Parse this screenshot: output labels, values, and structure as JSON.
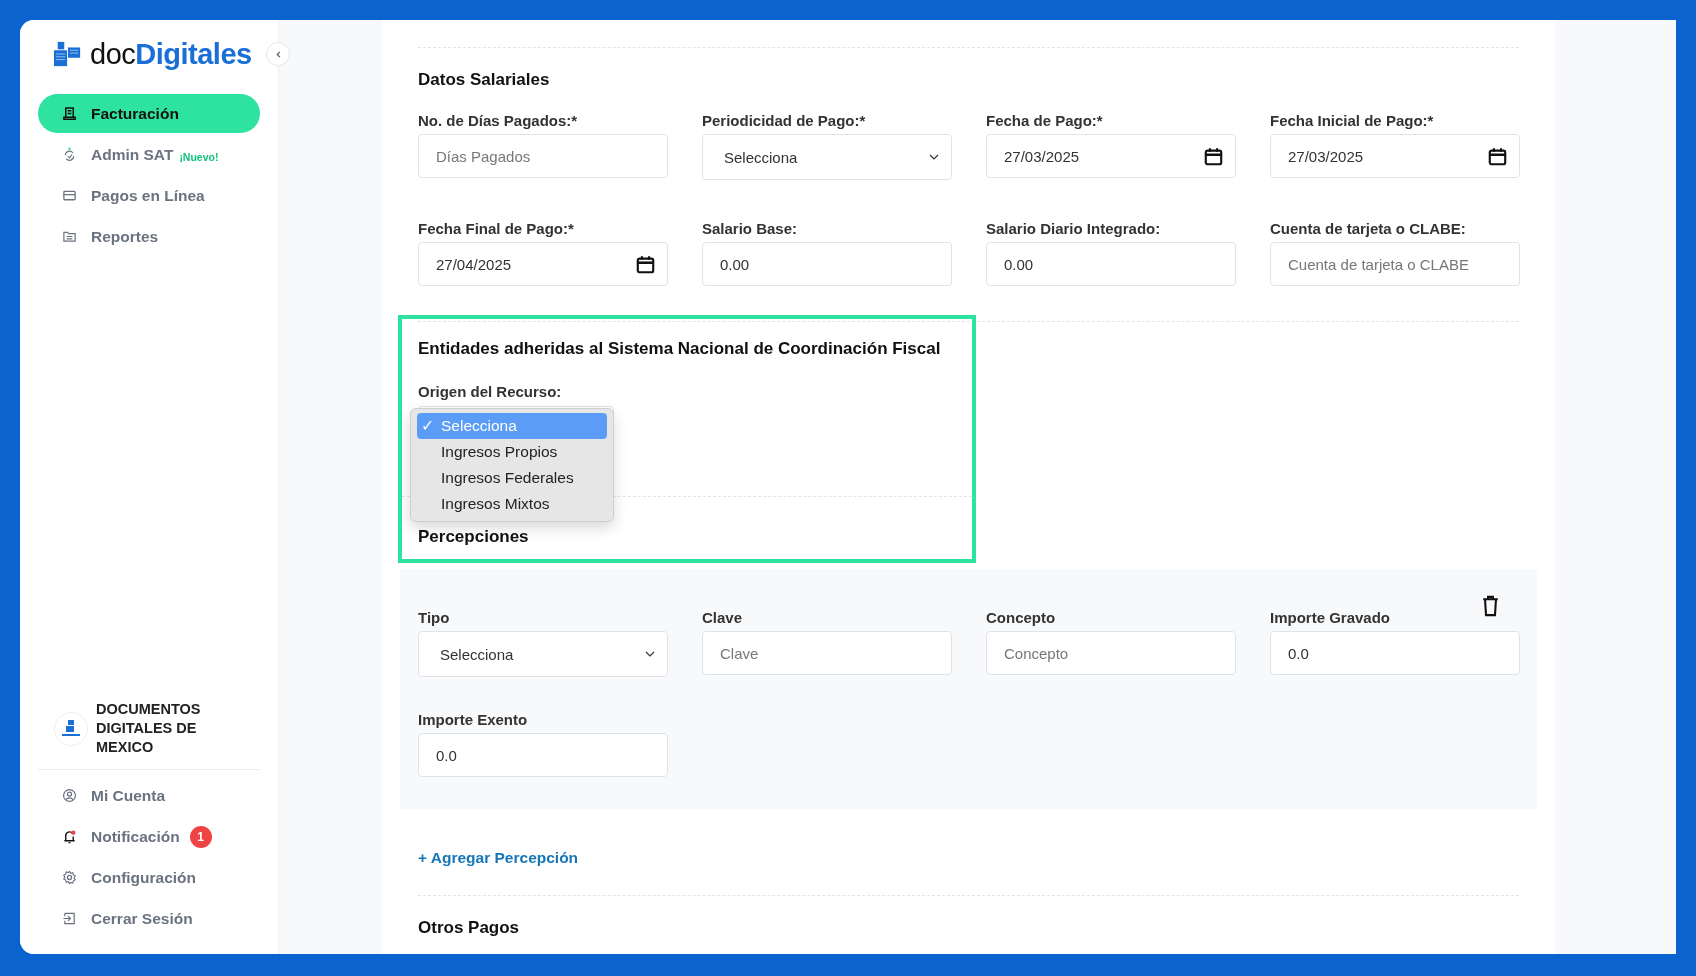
{
  "sidebar": {
    "logo": {
      "prefix": "doc",
      "brand": "Digitales"
    },
    "nav": [
      {
        "label": "Facturación",
        "selected": true
      },
      {
        "label": "Admin SAT",
        "tag": "¡Nuevo!",
        "selected": false
      },
      {
        "label": "Pagos en Línea",
        "selected": false
      },
      {
        "label": "Reportes",
        "selected": false
      }
    ],
    "company": {
      "name": "DOCUMENTOS DIGITALES DE MEXICO"
    },
    "account_menu": [
      {
        "label": "Mi Cuenta"
      },
      {
        "label": "Notificación",
        "badge": "1"
      },
      {
        "label": "Configuración"
      },
      {
        "label": "Cerrar Sesión"
      }
    ]
  },
  "datos_salariales": {
    "title": "Datos Salariales",
    "fields": [
      {
        "label": "No. de Días Pagados:*",
        "kind": "text",
        "placeholder": "Días Pagados"
      },
      {
        "label": "Periodicidad de Pago:*",
        "kind": "select",
        "value": "Selecciona"
      },
      {
        "label": "Fecha de Pago:*",
        "kind": "date",
        "value": "27/03/2025"
      },
      {
        "label": "Fecha Inicial de Pago:*",
        "kind": "date",
        "value": "27/03/2025"
      },
      {
        "label": "Fecha Final de Pago:*",
        "kind": "date",
        "value": "27/04/2025"
      },
      {
        "label": "Salario Base:",
        "kind": "text",
        "value": "0.00"
      },
      {
        "label": "Salario Diario Integrado:",
        "kind": "text",
        "value": "0.00"
      },
      {
        "label": "Cuenta de tarjeta o CLABE:",
        "kind": "text",
        "placeholder": "Cuenta de tarjeta o CLABE"
      }
    ]
  },
  "entidades": {
    "title": "Entidades adheridas al Sistema Nacional de Coordinación Fiscal",
    "field_label": "Origen del Recurso:",
    "check_glyph": "✓",
    "options": [
      {
        "label": "Selecciona",
        "selected": true
      },
      {
        "label": "Ingresos Propios",
        "selected": false
      },
      {
        "label": "Ingresos Federales",
        "selected": false
      },
      {
        "label": "Ingresos Mixtos",
        "selected": false
      }
    ]
  },
  "percepciones": {
    "title": "Percepciones",
    "fields": [
      {
        "label": "Tipo",
        "kind": "select",
        "value": "Selecciona"
      },
      {
        "label": "Clave",
        "kind": "text",
        "placeholder": "Clave"
      },
      {
        "label": "Concepto",
        "kind": "text",
        "placeholder": "Concepto"
      },
      {
        "label": "Importe Gravado",
        "kind": "text",
        "value": "0.0"
      },
      {
        "label": "Importe Exento",
        "kind": "text",
        "value": "0.0"
      }
    ],
    "add_link": "+ Agregar Percepción"
  },
  "otros_pagos": {
    "title": "Otros Pagos"
  }
}
